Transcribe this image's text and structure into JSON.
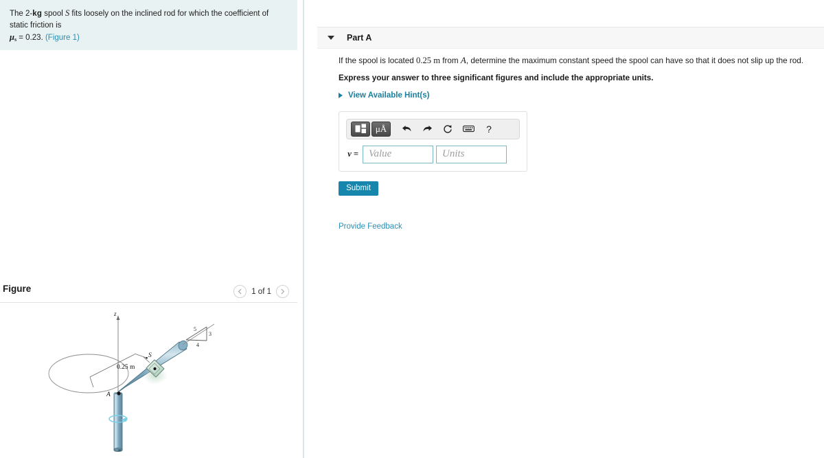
{
  "problem": {
    "text_before_kg": "The 2-",
    "kg": "kg",
    "text_after_kg": " spool ",
    "spool_symbol": "S",
    "text_mid": " fits loosely on the inclined rod for which the coefficient of static friction is",
    "mu_symbol": "μ",
    "mu_subscript": "s",
    "mu_value": " = 0.23.",
    "figure_link": "(Figure 1)"
  },
  "figure": {
    "title": "Figure",
    "pager_label": "1 of 1",
    "prev_icon": "chevron-left-icon",
    "next_icon": "chevron-right-icon",
    "labels": {
      "z_axis": "z",
      "point_a": "A",
      "spool": "S",
      "radius": "0.25 m",
      "slope_hyp": "5",
      "slope_vert": "3",
      "slope_horiz": "4"
    },
    "colors": {
      "rod": "#7fa8bd",
      "rod_light": "#cfe0e8",
      "spool": "#cfe5d8",
      "rotation_arrow": "#7fd2e8",
      "axis": "#7a7a7a"
    }
  },
  "part_a": {
    "title": "Part A",
    "caret_icon": "caret-down-icon",
    "question_1": "If the spool is located ",
    "question_distance": "0.25 m",
    "question_2": " from ",
    "question_point": "A",
    "question_3": ", determine the maximum constant speed the spool can have so that it does not slip up the rod.",
    "instruction": "Express your answer to three significant figures and include the appropriate units.",
    "hints_label": "View Available Hint(s)",
    "hints_caret_icon": "caret-right-icon"
  },
  "answer": {
    "variable_label": "v =",
    "value_placeholder": "Value",
    "units_placeholder": "Units",
    "value_current": "",
    "units_current": "",
    "toolbar": [
      {
        "name": "math-template-button",
        "glyph": ""
      },
      {
        "name": "micro-angstrom-units-button",
        "glyph": "μÅ"
      },
      {
        "name": "undo-button",
        "glyph": "↶"
      },
      {
        "name": "redo-button",
        "glyph": "↷"
      },
      {
        "name": "reset-button",
        "glyph": "⟳"
      },
      {
        "name": "keyboard-button",
        "glyph": "⌨"
      },
      {
        "name": "help-button",
        "glyph": "?"
      }
    ],
    "submit_label": "Submit"
  },
  "footer": {
    "feedback_label": "Provide Feedback"
  },
  "theme": {
    "accent": "#1a7fa0",
    "link": "#2b8eb3",
    "submit_bg": "#1686ad",
    "statement_bg": "#e9f2f2",
    "header_bg": "#f7f7f7",
    "field_border": "#7ab8c4"
  }
}
